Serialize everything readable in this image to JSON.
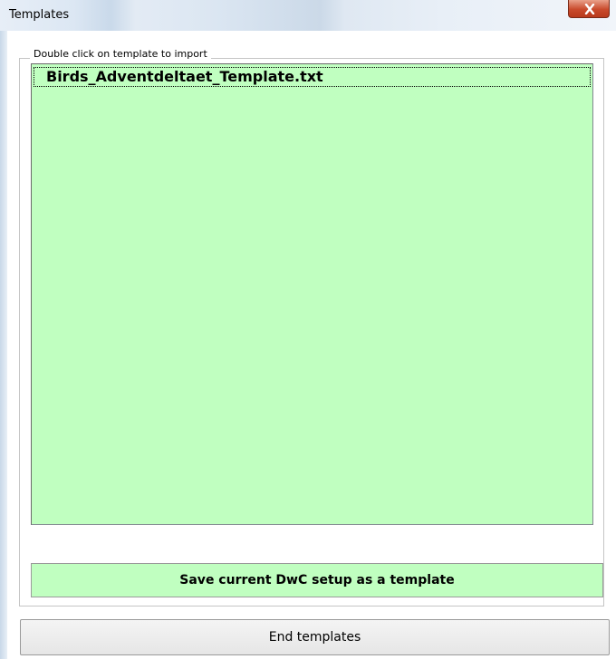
{
  "window": {
    "title": "Templates",
    "close_icon": "close-icon"
  },
  "group": {
    "label": "Double click on template to import"
  },
  "templates": [
    {
      "name": "Birds_Adventdeltaet_Template.txt"
    }
  ],
  "buttons": {
    "save_label": "Save current DwC setup as a template",
    "end_label": "End templates"
  },
  "colors": {
    "list_bg": "#c0ffc0",
    "close_red": "#c94a2c"
  }
}
